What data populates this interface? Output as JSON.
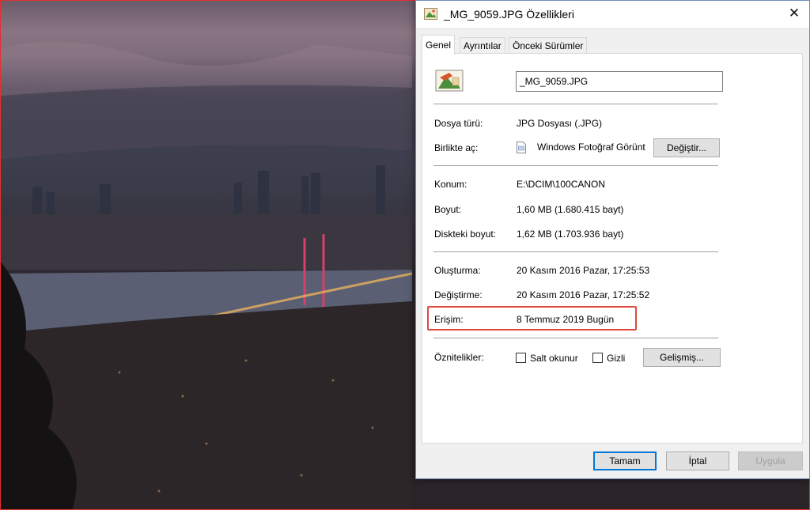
{
  "window": {
    "title": "_MG_9059.JPG Özellikleri",
    "close_glyph": "✕"
  },
  "tabs": [
    {
      "label": "Genel",
      "active": true
    },
    {
      "label": "Ayrıntılar",
      "active": false
    },
    {
      "label": "Önceki Sürümler",
      "active": false
    }
  ],
  "file": {
    "name": "_MG_9059.JPG",
    "type_label": "Dosya türü:",
    "type_value": "JPG Dosyası (.JPG)",
    "open_with_label": "Birlikte aç:",
    "open_with_value": "Windows Fotoğraf Görünt",
    "change_button": "Değiştir...",
    "location_label": "Konum:",
    "location_value": "E:\\DCIM\\100CANON",
    "size_label": "Boyut:",
    "size_value": "1,60 MB (1.680.415 bayt)",
    "disk_size_label": "Diskteki boyut:",
    "disk_size_value": "1,62 MB (1.703.936 bayt)"
  },
  "dates": {
    "created_label": "Oluşturma:",
    "created_value": "20 Kasım 2016 Pazar, 17:25:53",
    "modified_label": "Değiştirme:",
    "modified_value": "20 Kasım 2016 Pazar, 17:25:52",
    "accessed_label": "Erişim:",
    "accessed_value": "8 Temmuz 2019 Bugün"
  },
  "attributes": {
    "label": "Öznitelikler:",
    "readonly_label": "Salt okunur",
    "readonly_checked": false,
    "hidden_label": "Gizli",
    "hidden_checked": false,
    "advanced_button": "Gelişmiş..."
  },
  "footer": {
    "ok": "Tamam",
    "cancel": "İptal",
    "apply": "Uygula"
  },
  "colors": {
    "highlight": "#e0483e",
    "accent": "#0078d7"
  }
}
